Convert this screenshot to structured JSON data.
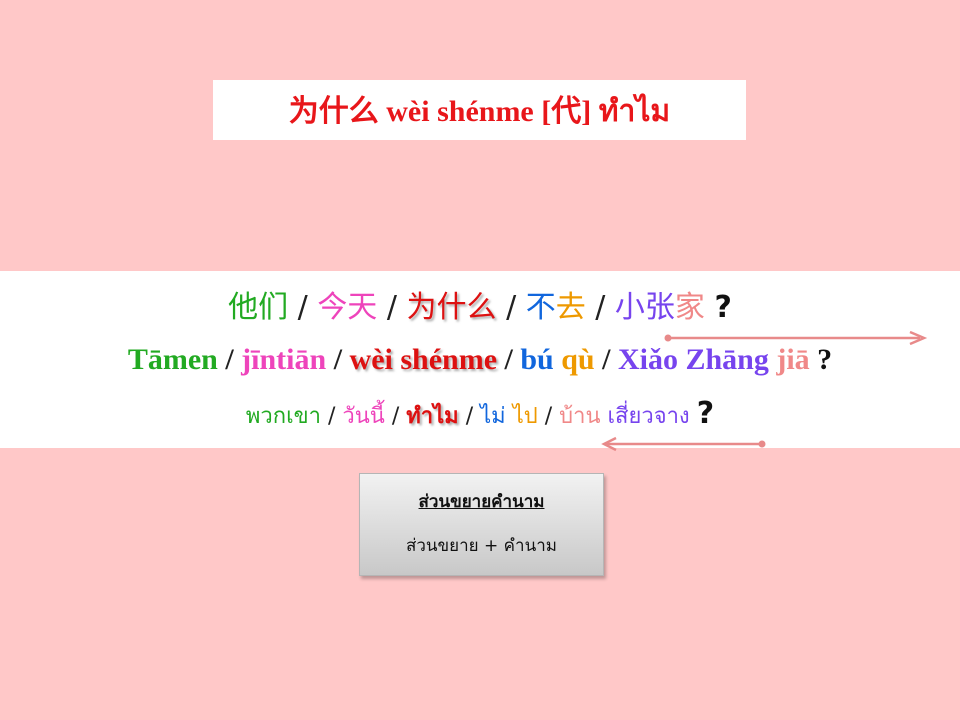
{
  "title": "为什么 wèi shénme [代] ทำไม",
  "sentence": {
    "hanzi": [
      {
        "text": "他们",
        "color": "#22aa22"
      },
      {
        "text": "今天",
        "color": "#ee44bb"
      },
      {
        "text": "为什么",
        "color": "#dd1111",
        "highlight": true
      },
      {
        "text": "不",
        "color": "#1166dd"
      },
      {
        "text": "去",
        "color": "#ee9900"
      },
      {
        "text": "小",
        "color": "#7744ee"
      },
      {
        "text": "张",
        "color": "#7744ee"
      },
      {
        "text": "家",
        "color": "#f08888"
      }
    ],
    "pinyin": [
      {
        "text": "Tāmen",
        "color": "#22aa22"
      },
      {
        "text": "jīntiān",
        "color": "#ee44bb"
      },
      {
        "text": "wèi shénme",
        "color": "#dd1111",
        "highlight": true
      },
      {
        "text": "bú",
        "color": "#1166dd"
      },
      {
        "text": "qù",
        "color": "#ee9900"
      },
      {
        "text": "Xiǎo Zhāng",
        "color": "#7744ee"
      },
      {
        "text": "jiā",
        "color": "#f08888"
      }
    ],
    "thai": [
      {
        "text": "พวกเขา",
        "color": "#22aa22"
      },
      {
        "text": "วันนี้",
        "color": "#ee44bb"
      },
      {
        "text": "ทำไม",
        "color": "#dd1111",
        "highlight": true
      },
      {
        "text": "ไม่",
        "color": "#1166dd"
      },
      {
        "text": "ไป",
        "color": "#ee9900"
      },
      {
        "text": "บ้าน",
        "color": "#f08888"
      },
      {
        "text": "เสี่ยวจาง",
        "color": "#7744ee"
      }
    ],
    "separator": "/",
    "question_mark": "?"
  },
  "note": {
    "title": "ส่วนขยายคำนาม",
    "formula": "ส่วนขยาย + คำนาม"
  },
  "arrow_color": "#e88a8a"
}
